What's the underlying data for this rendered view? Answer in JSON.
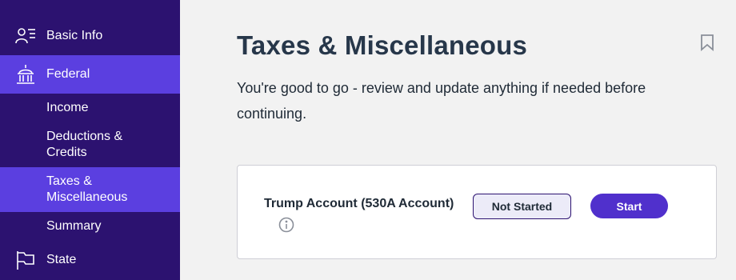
{
  "sidebar": {
    "items": [
      {
        "label": "Basic Info",
        "icon": "person-list-icon"
      },
      {
        "label": "Federal",
        "icon": "capitol-icon"
      },
      {
        "label": "Income"
      },
      {
        "label": "Deductions & Credits"
      },
      {
        "label": "Taxes & Miscellaneous"
      },
      {
        "label": "Summary"
      },
      {
        "label": "State",
        "icon": "flag-icon"
      }
    ],
    "active_color": "#5b3fe0",
    "background_color": "#2c1270"
  },
  "main": {
    "title": "Taxes & Miscellaneous",
    "subtitle": "You're good to go - review and update anything if needed before continuing.",
    "card": {
      "title": "Trump Account (530A Account)",
      "status": "Not Started",
      "action_label": "Start"
    }
  }
}
